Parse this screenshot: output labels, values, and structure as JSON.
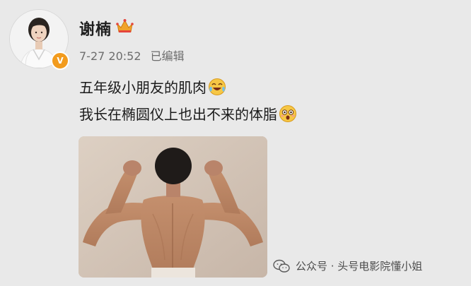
{
  "post": {
    "username": "谢楠",
    "timestamp": "7-27 20:52",
    "edited_label": "已编辑",
    "line1": "五年级小朋友的肌肉",
    "line2": "我长在椭圆仪上也出不来的体脂",
    "verify_badge": "V",
    "icons": {
      "badge": "crown-icon",
      "emoji1": "laughing-crying-emoji",
      "emoji2": "shocked-emoji",
      "verify": "verified-badge-icon"
    }
  },
  "watermark": {
    "text": "公众号 · 头号电影院懂小姐",
    "icon": "wechat-icon"
  },
  "colors": {
    "background": "#e9e9e9",
    "verify_badge": "#f29b1d",
    "meta_text": "#6d6d6d"
  }
}
